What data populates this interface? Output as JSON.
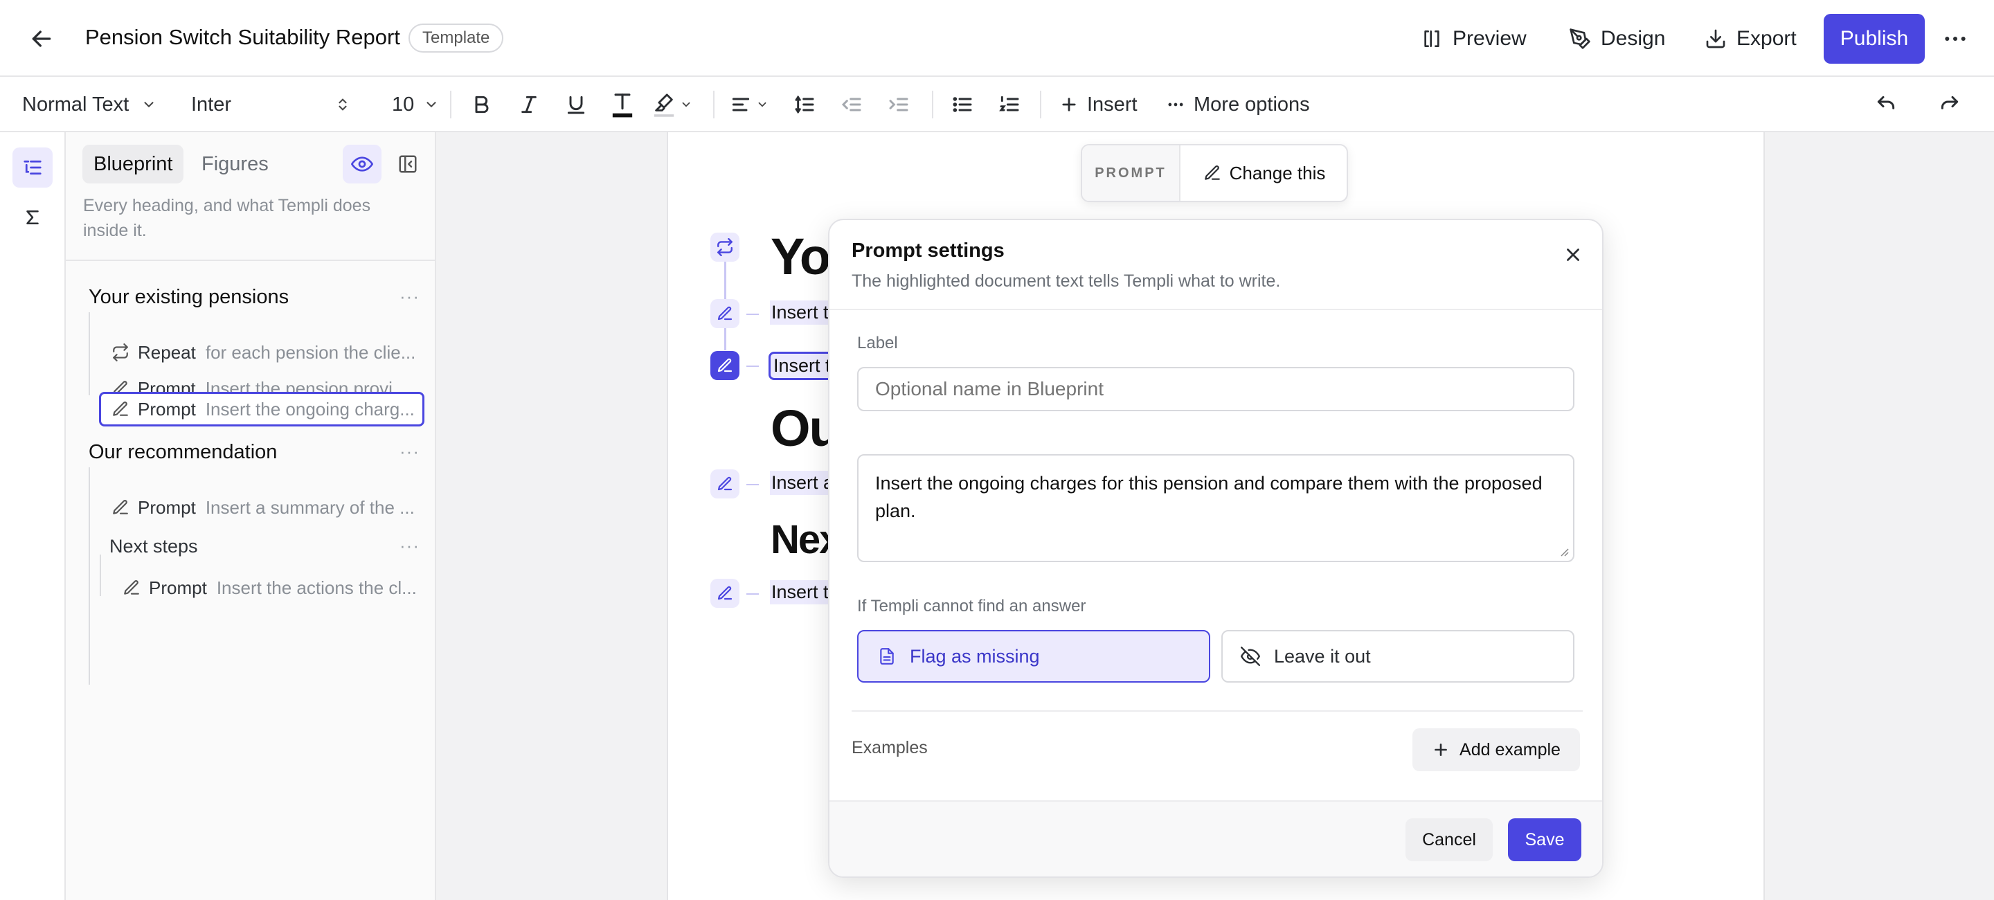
{
  "header": {
    "title": "Pension Switch Suitability Report",
    "badge": "Template",
    "preview_label": "Preview",
    "design_label": "Design",
    "export_label": "Export",
    "publish_label": "Publish"
  },
  "toolbar": {
    "text_style": "Normal Text",
    "font": "Inter",
    "font_size": "10",
    "insert_label": "Insert",
    "more_label": "More options"
  },
  "sidebar": {
    "tabs": [
      "Blueprint",
      "Figures"
    ],
    "description": "Every heading, and what Templi does inside it.",
    "tree": [
      {
        "type": "heading",
        "label": "Your existing pensions"
      },
      {
        "type": "item",
        "kind": "Repeat",
        "text": "for each pension the clie..."
      },
      {
        "type": "item",
        "kind": "Prompt",
        "text": "Insert the pension provid..."
      },
      {
        "type": "item",
        "kind": "Prompt",
        "text": "Insert the ongoing charg..."
      },
      {
        "type": "heading",
        "label": "Our recommendation"
      },
      {
        "type": "item",
        "kind": "Prompt",
        "text": "Insert a summary of the ..."
      },
      {
        "type": "subheading",
        "label": "Next steps"
      },
      {
        "type": "item",
        "kind": "Prompt",
        "text": "Insert the actions the cl..."
      }
    ]
  },
  "floating_toolbar": {
    "tag": "PROMPT",
    "change_label": "Change this"
  },
  "document": {
    "headings": [
      "You",
      "Ou",
      "Nex"
    ],
    "lines": [
      "Insert t",
      "Insert t",
      "Insert a",
      "Insert t"
    ]
  },
  "modal": {
    "title": "Prompt settings",
    "subtitle": "The highlighted document text tells Templi what to write.",
    "label_caption": "Label",
    "label_placeholder": "Optional name in Blueprint",
    "prompt_text": "Insert the ongoing charges for this pension and compare them with the proposed plan.",
    "fallback_caption": "If Templi cannot find an answer",
    "fallback_options": [
      "Flag as missing",
      "Leave it out"
    ],
    "fallback_selected": "Flag as missing",
    "examples_label": "Examples",
    "add_example_label": "Add example",
    "cancel_label": "Cancel",
    "save_label": "Save"
  },
  "colors": {
    "accent": "#4a46e0",
    "accent_soft": "#eceafd",
    "canvas": "#f2f2f3"
  },
  "icons": [
    "back-arrow-icon",
    "preview-icon",
    "design-icon",
    "export-icon",
    "more-icon",
    "bold-icon",
    "italic-icon",
    "underline-icon",
    "text-color-icon",
    "highlight-icon",
    "align-icon",
    "line-height-icon",
    "outdent-icon",
    "indent-icon",
    "bullet-list-icon",
    "numbered-list-icon",
    "plus-icon",
    "undo-icon",
    "redo-icon",
    "outline-icon",
    "sigma-icon",
    "eye-icon",
    "collapse-panel-icon",
    "repeat-icon",
    "pencil-icon",
    "close-icon",
    "document-icon",
    "eye-off-icon"
  ]
}
